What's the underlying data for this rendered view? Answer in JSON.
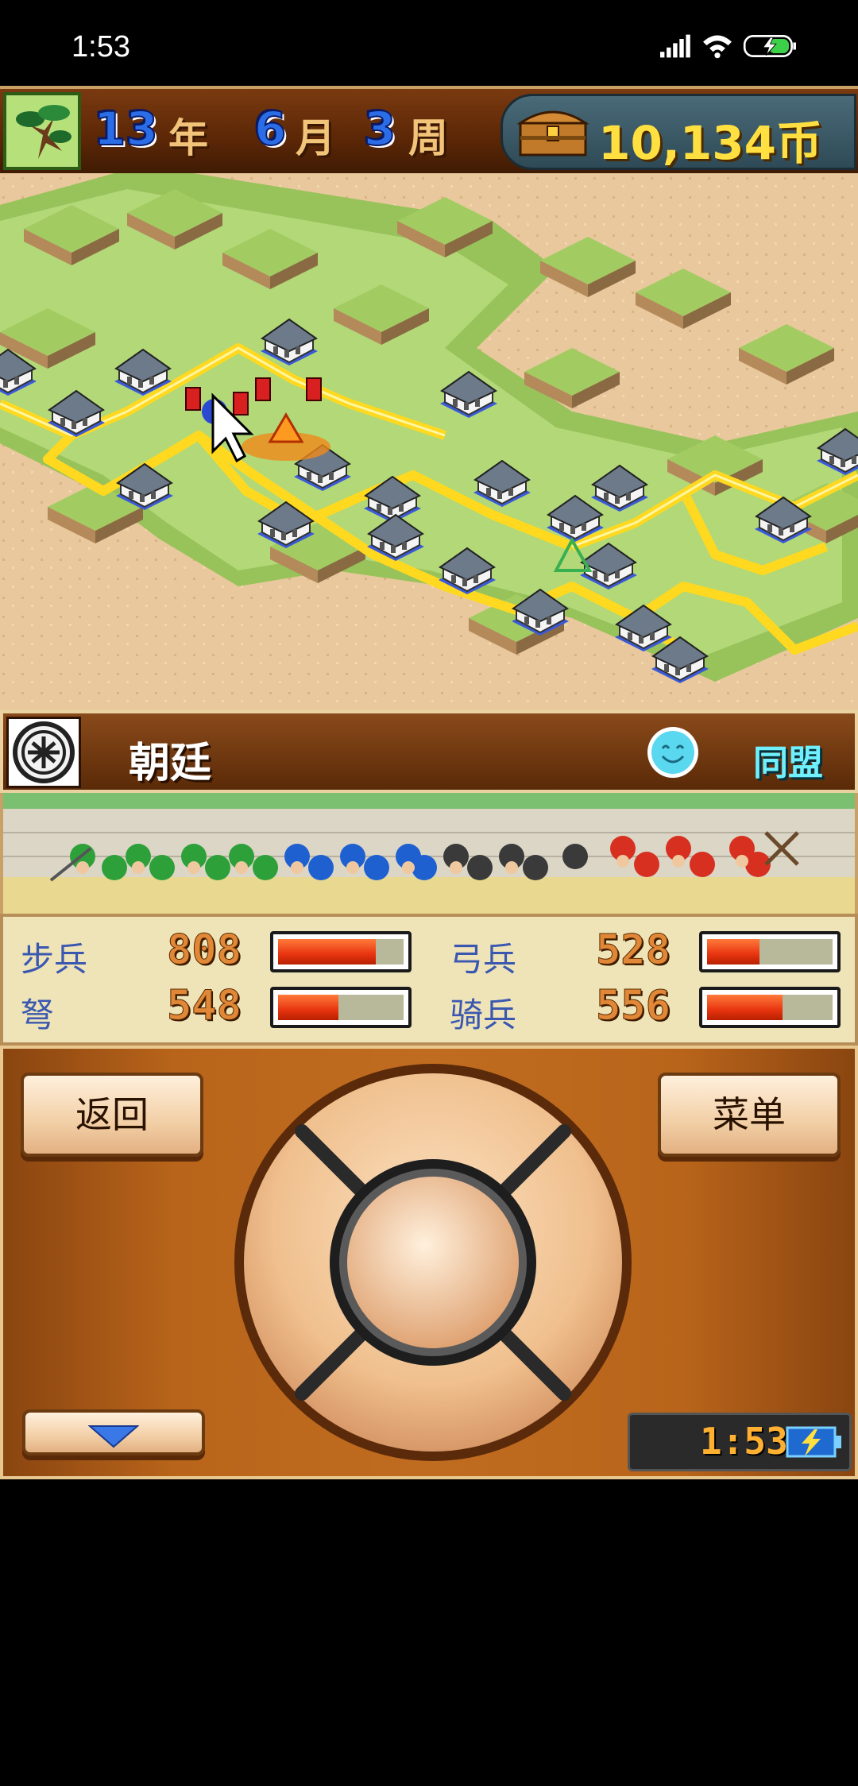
{
  "status_bar": {
    "time": "1:53"
  },
  "hud": {
    "year_num": "13",
    "year_unit": "年",
    "month_num": "6",
    "month_unit": "月",
    "week_num": "3",
    "week_unit": "周",
    "coins": "10,134币"
  },
  "faction": {
    "name": "朝廷",
    "status": "同盟"
  },
  "stats": [
    {
      "label": "步兵",
      "value": "808",
      "level": 0.78
    },
    {
      "label": "弓兵",
      "value": "528",
      "level": 0.42
    },
    {
      "label": "弩",
      "value": "548",
      "level": 0.48
    },
    {
      "label": "骑兵",
      "value": "556",
      "level": 0.6
    }
  ],
  "controls": {
    "back": "返回",
    "menu": "菜单"
  },
  "game_clock": "1:53"
}
